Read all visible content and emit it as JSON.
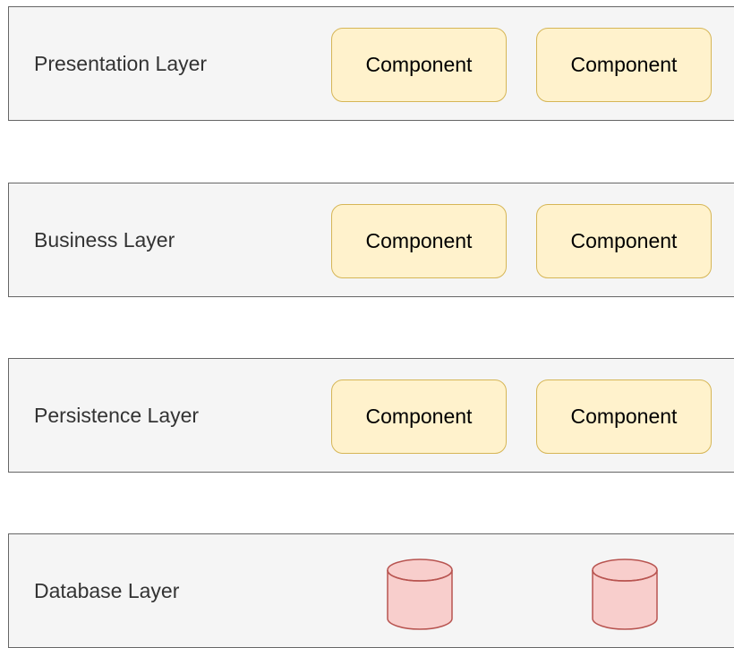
{
  "diagram": {
    "layers": [
      {
        "label": "Presentation Layer",
        "components": [
          "Component",
          "Component"
        ]
      },
      {
        "label": "Business Layer",
        "components": [
          "Component",
          "Component"
        ]
      },
      {
        "label": "Persistence Layer",
        "components": [
          "Component",
          "Component"
        ]
      },
      {
        "label": "Database Layer",
        "databases": [
          "database-icon",
          "database-icon"
        ]
      }
    ]
  },
  "colors": {
    "layer_fill": "#f5f5f5",
    "layer_stroke": "#666666",
    "component_fill": "#fff2cc",
    "component_stroke": "#d6b656",
    "database_fill": "#f8cecc",
    "database_stroke": "#b85450"
  }
}
